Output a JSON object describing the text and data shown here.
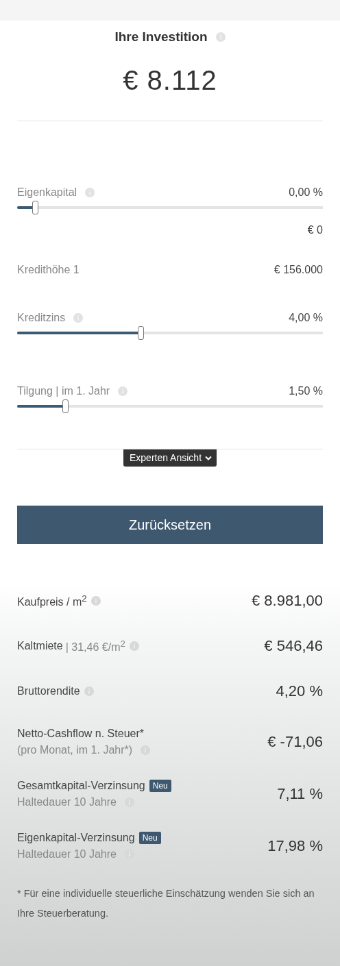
{
  "investment": {
    "title": "Ihre Investition",
    "info": true,
    "amount": "€ 8.112"
  },
  "params": [
    {
      "kind": "slider",
      "label": "Eigenkapital",
      "info": true,
      "value": "0,00 %",
      "level": 0.06,
      "sub_value": "€ 0"
    },
    {
      "kind": "plain",
      "label": "Kredithöhe 1",
      "info": false,
      "value": "€ 156.000"
    },
    {
      "kind": "slider",
      "label": "Kreditzins",
      "info": true,
      "value": "4,00 %",
      "level": 0.405
    },
    {
      "kind": "slider",
      "label": "Tilgung | im 1. Jahr",
      "info": true,
      "value": "1,50 %",
      "level": 0.16
    }
  ],
  "expert_toggle": {
    "label": "Experten Ansicht",
    "expanded": false
  },
  "reset_button": "Zurücksetzen",
  "results": [
    {
      "label": "Kaufpreis / m$^{2}$",
      "info": true,
      "value": "€ 8.981,00"
    },
    {
      "label": "Kaltmiete",
      "note": "| 31,46 €/m$^{2}$",
      "info": true,
      "value": "€ 546,46"
    },
    {
      "label": "Bruttorendite",
      "info": true,
      "value": "4,20 %"
    },
    {
      "label": "Netto-Cashflow n. Steuer*",
      "sublabel": "(pro Monat, im 1. Jahr*)",
      "info": true,
      "value": "€ -71,06"
    },
    {
      "label": "Gesamtkapital-Verzinsung",
      "badge": "Neu",
      "sublabel": "Haltedauer 10 Jahre",
      "info": true,
      "value": "7,11 %"
    },
    {
      "label": "Eigenkapital-Verzinsung",
      "badge": "Neu",
      "sublabel": "Haltedauer 10 Jahre",
      "info": true,
      "value": "17,98 %"
    }
  ],
  "footnote": "* Für eine individuelle steuerliche Einschätzung wenden Sie sich an Ihre Steuerberatung."
}
